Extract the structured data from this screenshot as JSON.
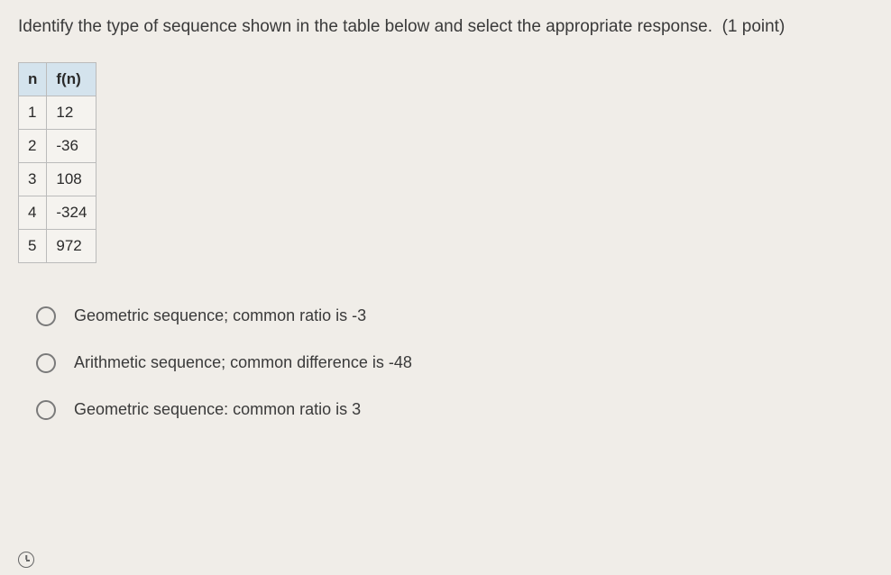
{
  "question": {
    "prompt": "Identify the type of sequence shown in the table below and select the appropriate response.",
    "points_label": "(1 point)"
  },
  "table": {
    "headers": {
      "col1": "n",
      "col2": "f(n)"
    },
    "rows": [
      {
        "n": "1",
        "fn": "12"
      },
      {
        "n": "2",
        "fn": "-36"
      },
      {
        "n": "3",
        "fn": "108"
      },
      {
        "n": "4",
        "fn": "-324"
      },
      {
        "n": "5",
        "fn": "972"
      }
    ]
  },
  "options": [
    {
      "text": "Geometric sequence; common ratio is -3"
    },
    {
      "text": "Arithmetic sequence; common difference is -48"
    },
    {
      "text": "Geometric sequence: common ratio is 3"
    }
  ],
  "chart_data": {
    "type": "table",
    "title": "Sequence values",
    "columns": [
      "n",
      "f(n)"
    ],
    "rows": [
      [
        1,
        12
      ],
      [
        2,
        -36
      ],
      [
        3,
        108
      ],
      [
        4,
        -324
      ],
      [
        5,
        972
      ]
    ]
  }
}
